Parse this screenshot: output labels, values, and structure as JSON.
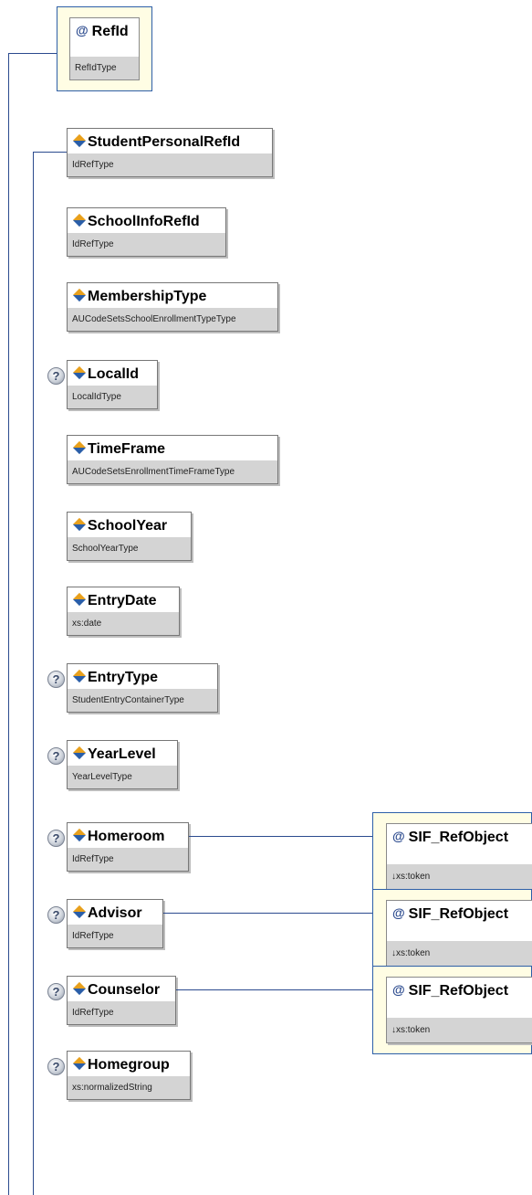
{
  "ref_id_attribute": {
    "name": "RefId",
    "type": "RefIdType"
  },
  "elements": [
    {
      "name": "StudentPersonalRefId",
      "type": "IdRefType",
      "optional": false
    },
    {
      "name": "SchoolInfoRefId",
      "type": "IdRefType",
      "optional": false
    },
    {
      "name": "MembershipType",
      "type": "AUCodeSetsSchoolEnrollmentTypeType",
      "optional": false
    },
    {
      "name": "LocalId",
      "type": "LocalIdType",
      "optional": true
    },
    {
      "name": "TimeFrame",
      "type": "AUCodeSetsEnrollmentTimeFrameType",
      "optional": false
    },
    {
      "name": "SchoolYear",
      "type": "SchoolYearType",
      "optional": false
    },
    {
      "name": "EntryDate",
      "type": "xs:date",
      "optional": false
    },
    {
      "name": "EntryType",
      "type": "StudentEntryContainerType",
      "optional": true
    },
    {
      "name": "YearLevel",
      "type": "YearLevelType",
      "optional": true
    },
    {
      "name": "Homeroom",
      "type": "IdRefType",
      "optional": true
    },
    {
      "name": "Advisor",
      "type": "IdRefType",
      "optional": true
    },
    {
      "name": "Counselor",
      "type": "IdRefType",
      "optional": true
    },
    {
      "name": "Homegroup",
      "type": "xs:normalizedString",
      "optional": true
    }
  ],
  "ref_objects": [
    {
      "name": "SIF_RefObject",
      "type": "↓xs:token"
    },
    {
      "name": "SIF_RefObject",
      "type": "↓xs:token"
    },
    {
      "name": "SIF_RefObject",
      "type": "↓xs:token"
    }
  ],
  "icons": {
    "attribute": "at-sign-icon",
    "element": "element-diamond-icon",
    "optional": "question-mark-icon"
  },
  "colors": {
    "connector": "#2b4a8e",
    "attribute_bg": "#fffde4",
    "type_bar": "#d4d4d4"
  }
}
